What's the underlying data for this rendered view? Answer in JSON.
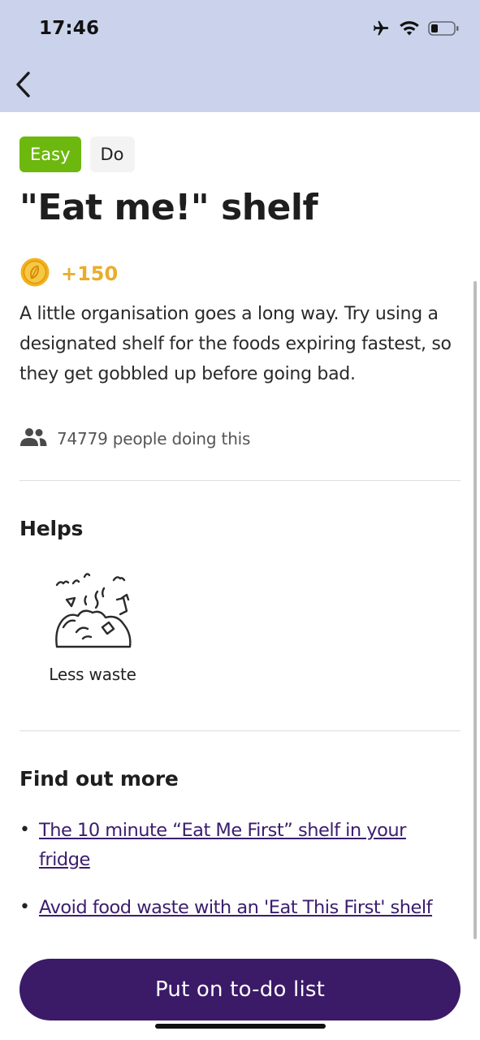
{
  "status_bar": {
    "time": "17:46",
    "icons": [
      "airplane-icon",
      "wifi-icon",
      "battery-icon"
    ]
  },
  "nav": {
    "back_icon": "chevron-left-icon"
  },
  "tags": [
    {
      "label": "Easy",
      "color": "#6db80e"
    },
    {
      "label": "Do"
    }
  ],
  "title": "\"Eat me!\" shelf",
  "points": {
    "icon": "coin-icon",
    "value": "+150",
    "color": "#e9ad2a"
  },
  "description": "A little organisation goes a long way. Try using a designated shelf for the foods expiring fastest, so they get gobbled up before going bad.",
  "people": {
    "icon": "people-icon",
    "text": "74779 people doing this"
  },
  "helps": {
    "heading": "Helps",
    "items": [
      {
        "icon": "waste-pile-icon",
        "label": "Less waste"
      }
    ]
  },
  "find_out_more": {
    "heading": "Find out more",
    "links": [
      {
        "text": "The 10 minute “Eat Me First” shelf in your fridge"
      },
      {
        "text": "Avoid food waste with an 'Eat This First' shelf"
      }
    ]
  },
  "cta": {
    "label": "Put on to-do list",
    "color": "#3b1a68"
  },
  "colors": {
    "header_background": "#cbd3ec",
    "link": "#3b1d6e"
  }
}
